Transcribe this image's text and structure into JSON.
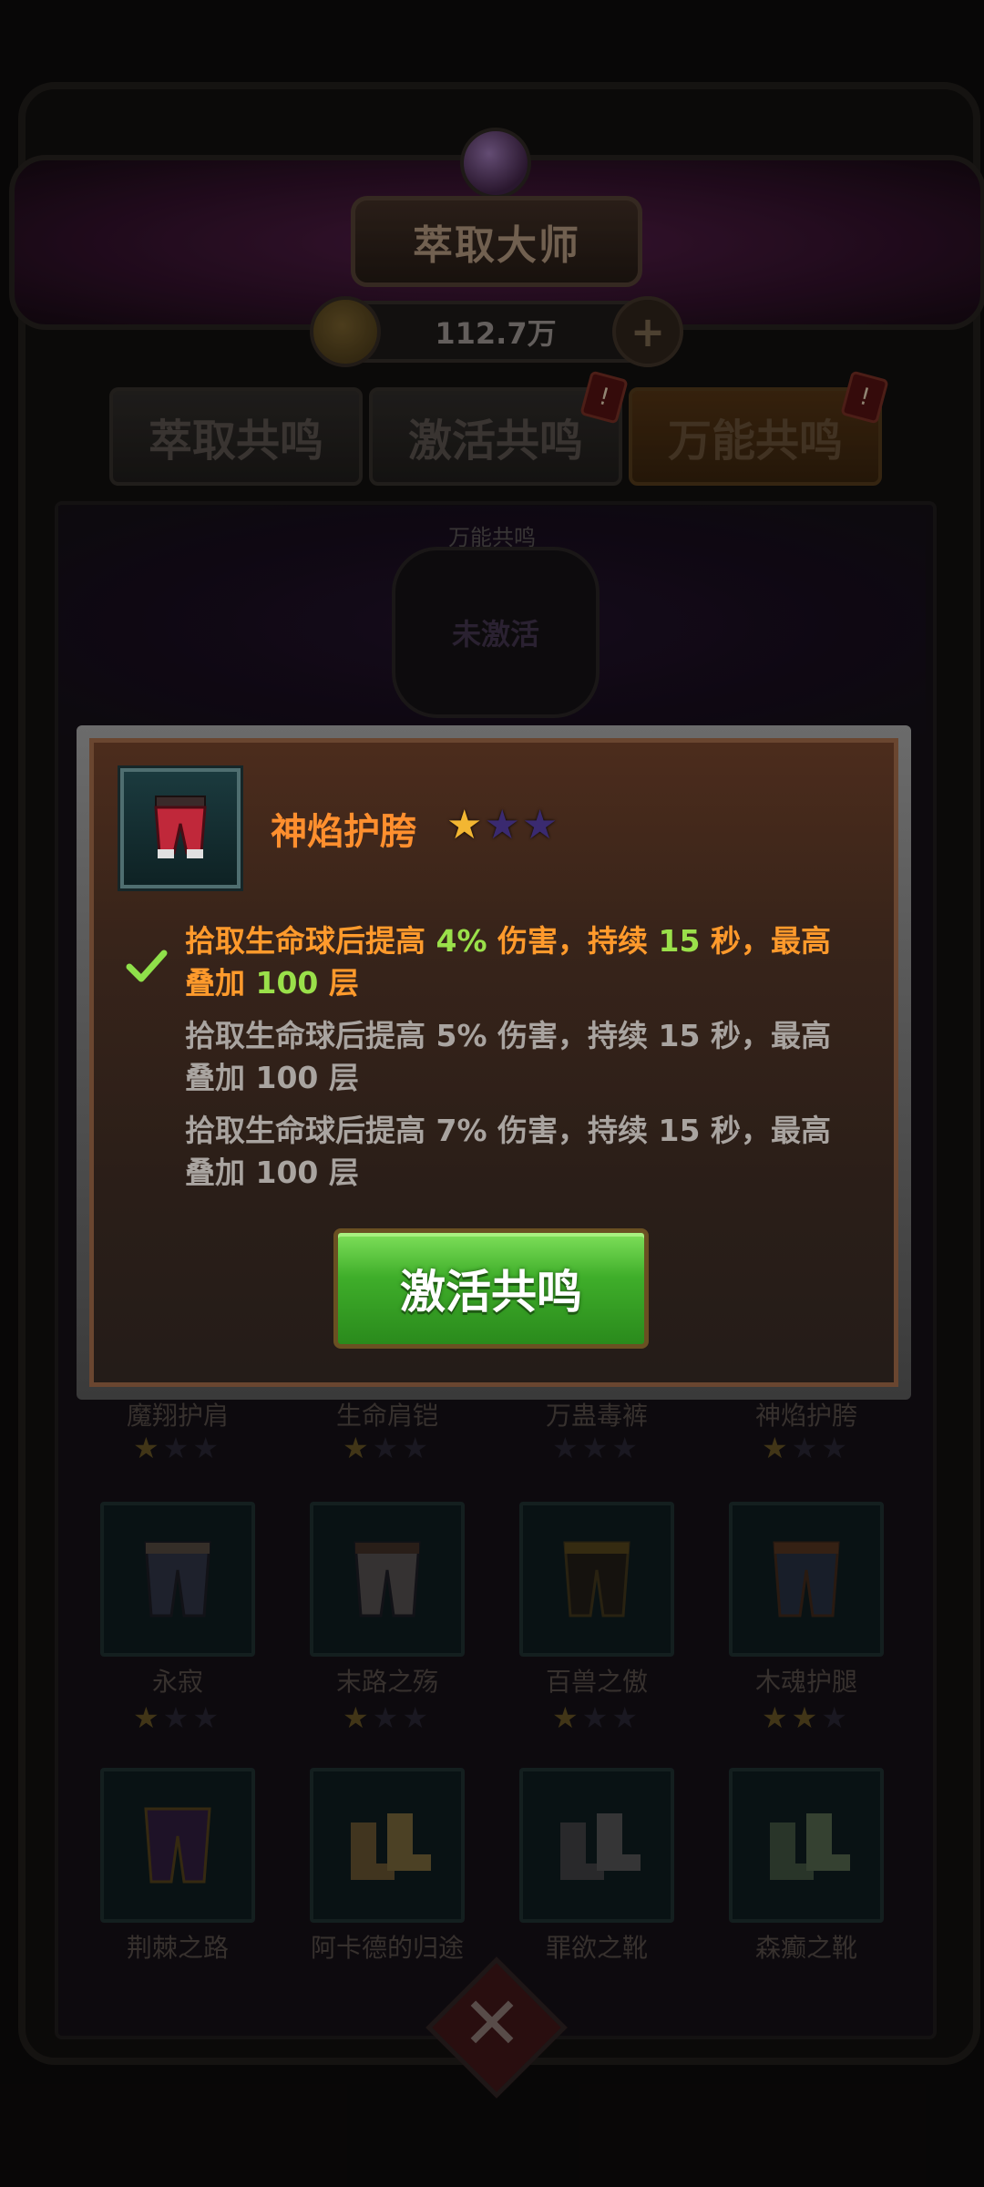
{
  "header": {
    "title": "萃取大师",
    "currency_amount": "112.7万"
  },
  "tabs": [
    {
      "label": "萃取共鸣",
      "active": false,
      "badge": false
    },
    {
      "label": "激活共鸣",
      "active": false,
      "badge": true
    },
    {
      "label": "万能共鸣",
      "active": true,
      "badge": true
    }
  ],
  "tab_badge_glyph": "!",
  "resonance_slot": {
    "label": "万能共鸣",
    "status": "未激活"
  },
  "grid": {
    "row0": [
      {
        "name": "魔翔护肩",
        "stars": 1
      },
      {
        "name": "生命肩铠",
        "stars": 1
      },
      {
        "name": "万蛊毒裤",
        "stars": 0
      },
      {
        "name": "神焰护胯",
        "stars": 1
      }
    ],
    "row1": [
      {
        "name": "永寂",
        "stars": 1
      },
      {
        "name": "末路之殇",
        "stars": 1
      },
      {
        "name": "百兽之傲",
        "stars": 1
      },
      {
        "name": "木魂护腿",
        "stars": 2
      }
    ],
    "row2": [
      {
        "name": "荆棘之路"
      },
      {
        "name": "阿卡德的归途"
      },
      {
        "name": "罪欲之靴"
      },
      {
        "name": "森癫之靴"
      }
    ]
  },
  "modal": {
    "item_name": "神焰护胯",
    "stars_total": 3,
    "stars_filled": 1,
    "effects": [
      {
        "active": true,
        "t1": "拾取生命球后提高 ",
        "pct": "4%",
        "t2": " 伤害，持续 ",
        "dur": "15",
        "t3": " 秒，最高叠加 ",
        "stack": "100",
        "t4": " 层"
      },
      {
        "active": false,
        "t1": "拾取生命球后提高 ",
        "pct": "5%",
        "t2": " 伤害，持续 ",
        "dur": "15",
        "t3": " 秒，最高叠加 ",
        "stack": "100",
        "t4": " 层"
      },
      {
        "active": false,
        "t1": "拾取生命球后提高 ",
        "pct": "7%",
        "t2": " 伤害，持续 ",
        "dur": "15",
        "t3": " 秒，最高叠加 ",
        "stack": "100",
        "t4": " 层"
      }
    ],
    "activate_label": "激活共鸣"
  },
  "colors": {
    "item_name": "#ff8f2e",
    "highlight_value": "#9ae04a",
    "active_effect": "#ff9a2c",
    "inactive_effect": "#a9a4a0",
    "button_green": "#3fae2a"
  },
  "icons": {
    "check": "check-icon",
    "star": "star-icon",
    "coin": "coin-icon",
    "plus": "plus-icon"
  }
}
